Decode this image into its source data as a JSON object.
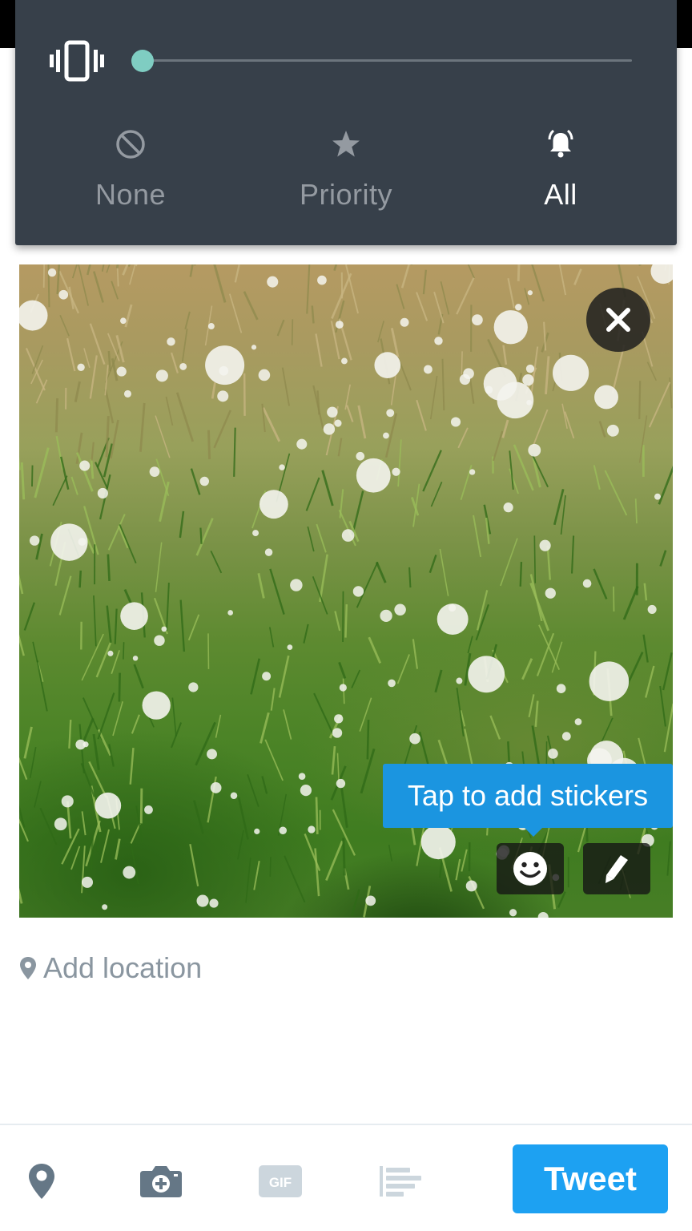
{
  "dnd_panel": {
    "ringer_level": 0.0,
    "modes": [
      {
        "id": "none",
        "label": "None",
        "icon": "block-icon",
        "active": false
      },
      {
        "id": "priority",
        "label": "Priority",
        "icon": "star-icon",
        "active": false
      },
      {
        "id": "all",
        "label": "All",
        "icon": "bell-ringing-icon",
        "active": true
      }
    ]
  },
  "photo": {
    "sticker_tooltip": "Tap to add stickers",
    "tools": [
      "sticker-icon",
      "pencil-icon"
    ]
  },
  "location": {
    "label": "Add location"
  },
  "bottom_bar": {
    "icons": [
      "location-pin-icon",
      "camera-add-icon",
      "gif-icon",
      "poll-icon"
    ],
    "gif_label": "GIF",
    "tweet_label": "Tweet"
  },
  "colors": {
    "accent": "#1da1f2",
    "tooltip": "#1b95e0",
    "panel": "#37404a",
    "slider": "#7fcdc2"
  }
}
